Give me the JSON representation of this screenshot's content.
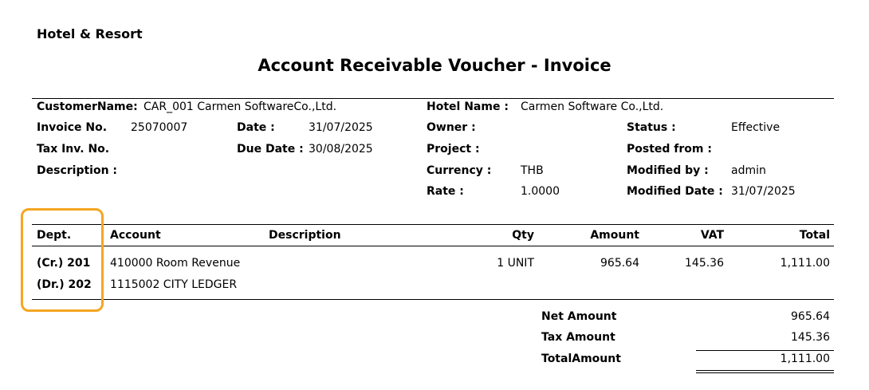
{
  "org_name": "Hotel & Resort",
  "doc_title": "Account Receivable Voucher - Invoice",
  "header": {
    "customer_label": "CustomerName:",
    "customer_value": "CAR_001 Carmen SoftwareCo.,Ltd.",
    "invoice_no_label": "Invoice No.",
    "invoice_no_value": "25070007",
    "date_label": "Date :",
    "date_value": "31/07/2025",
    "tax_inv_label": "Tax Inv. No.",
    "due_date_label": "Due Date :",
    "due_date_value": "30/08/2025",
    "description_label": "Description :",
    "hotel_name_label": "Hotel Name :",
    "hotel_name_value": "Carmen Software Co.,Ltd.",
    "owner_label": "Owner :",
    "project_label": "Project :",
    "currency_label": "Currency :",
    "currency_value": "THB",
    "rate_label": "Rate :",
    "rate_value": "1.0000",
    "status_label": "Status :",
    "status_value": "Effective",
    "posted_from_label": "Posted from :",
    "modified_by_label": "Modified by :",
    "modified_by_value": "admin",
    "modified_date_label": "Modified Date :",
    "modified_date_value": "31/07/2025"
  },
  "table": {
    "columns": [
      "Dept.",
      "Account",
      "Description",
      "Qty",
      "Amount",
      "VAT",
      "Total"
    ],
    "rows": [
      {
        "dept": "(Cr.) 201",
        "account": "410000 Room Revenue",
        "description": "",
        "qty": "1 UNIT",
        "amount": "965.64",
        "vat": "145.36",
        "total": "1,111.00"
      },
      {
        "dept": "(Dr.) 202",
        "account": "1115002 CITY LEDGER",
        "description": "",
        "qty": "",
        "amount": "",
        "vat": "",
        "total": ""
      }
    ]
  },
  "totals": {
    "net_label": "Net Amount",
    "net_value": "965.64",
    "tax_label": "Tax Amount",
    "tax_value": "145.36",
    "total_label": "TotalAmount",
    "total_value": "1,111.00"
  },
  "colors": {
    "highlight": "#f5a623"
  }
}
